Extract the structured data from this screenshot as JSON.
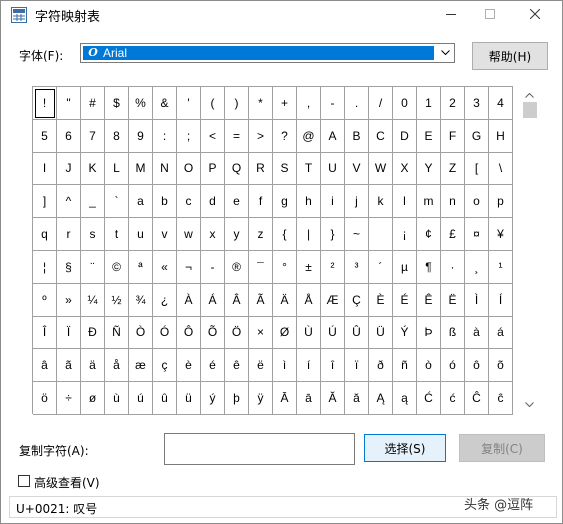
{
  "window": {
    "title": "字符映射表"
  },
  "font_row": {
    "label": "字体(F):",
    "value": "Arial",
    "help_button": "帮助(H)"
  },
  "grid": {
    "rows": [
      [
        "!",
        "\"",
        "#",
        "$",
        "%",
        "&",
        "'",
        "(",
        ")",
        "*",
        "+",
        ",",
        "-",
        ".",
        "/",
        "0",
        "1",
        "2",
        "3",
        "4"
      ],
      [
        "5",
        "6",
        "7",
        "8",
        "9",
        ":",
        ";",
        "<",
        "=",
        ">",
        "?",
        "@",
        "A",
        "B",
        "C",
        "D",
        "E",
        "F",
        "G",
        "H"
      ],
      [
        "I",
        "J",
        "K",
        "L",
        "M",
        "N",
        "O",
        "P",
        "Q",
        "R",
        "S",
        "T",
        "U",
        "V",
        "W",
        "X",
        "Y",
        "Z",
        "[",
        "\\"
      ],
      [
        "]",
        "^",
        "_",
        "`",
        "a",
        "b",
        "c",
        "d",
        "e",
        "f",
        "g",
        "h",
        "i",
        "j",
        "k",
        "l",
        "m",
        "n",
        "o",
        "p"
      ],
      [
        "q",
        "r",
        "s",
        "t",
        "u",
        "v",
        "w",
        "x",
        "y",
        "z",
        "{",
        "|",
        "}",
        "~",
        " ",
        "¡",
        "¢",
        "£",
        "¤",
        "¥"
      ],
      [
        "¦",
        "§",
        "¨",
        "©",
        "ª",
        "«",
        "¬",
        "-",
        "®",
        "¯",
        "°",
        "±",
        "²",
        "³",
        "´",
        "µ",
        "¶",
        "·",
        "¸",
        "¹"
      ],
      [
        "º",
        "»",
        "¼",
        "½",
        "¾",
        "¿",
        "À",
        "Á",
        "Â",
        "Ã",
        "Ä",
        "Å",
        "Æ",
        "Ç",
        "È",
        "É",
        "Ê",
        "Ë",
        "Ì",
        "Í"
      ],
      [
        "Î",
        "Ï",
        "Ð",
        "Ñ",
        "Ò",
        "Ó",
        "Ô",
        "Õ",
        "Ö",
        "×",
        "Ø",
        "Ù",
        "Ú",
        "Û",
        "Ü",
        "Ý",
        "Þ",
        "ß",
        "à",
        "á"
      ],
      [
        "â",
        "ã",
        "ä",
        "å",
        "æ",
        "ç",
        "è",
        "é",
        "ê",
        "ë",
        "ì",
        "í",
        "î",
        "ï",
        "ð",
        "ñ",
        "ò",
        "ó",
        "ô",
        "õ"
      ],
      [
        "ö",
        "÷",
        "ø",
        "ù",
        "ú",
        "û",
        "ü",
        "ý",
        "þ",
        "ÿ",
        "Ā",
        "ā",
        "Ă",
        "ă",
        "Ą",
        "ą",
        "Ć",
        "ć",
        "Ĉ",
        "ĉ"
      ]
    ],
    "selected": "!"
  },
  "copy_row": {
    "label": "复制字符(A):",
    "value": "",
    "select_button": "选择(S)",
    "copy_button": "复制(C)"
  },
  "advanced": {
    "label": "高级查看(V)",
    "checked": false
  },
  "status": {
    "text": "U+0021: 叹号"
  },
  "watermark": {
    "text": "头条 @逗阵"
  }
}
